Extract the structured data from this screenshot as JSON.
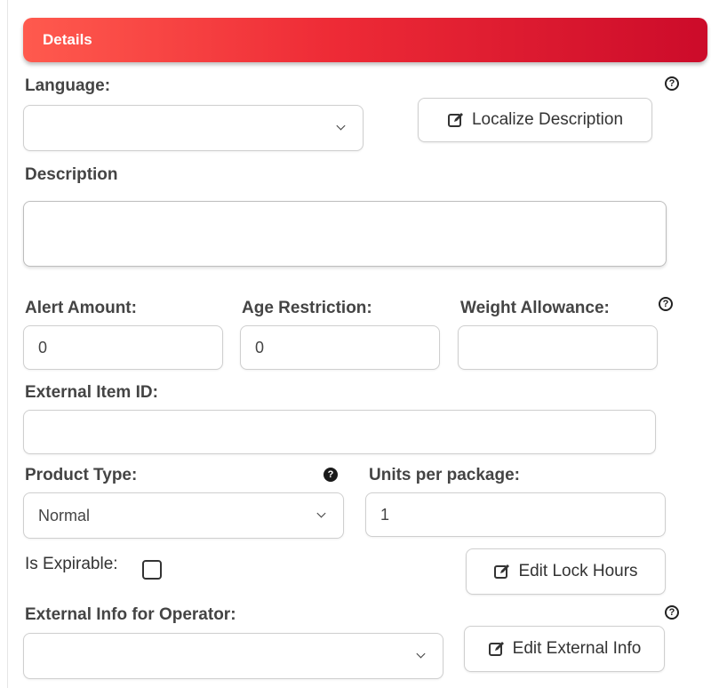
{
  "header": {
    "title": "Details"
  },
  "language": {
    "label": "Language:",
    "value": ""
  },
  "localize_button": {
    "label": "Localize Description"
  },
  "description": {
    "label": "Description",
    "value": ""
  },
  "alert_amount": {
    "label": "Alert Amount:",
    "value": "0"
  },
  "age_restriction": {
    "label": "Age Restriction:",
    "value": "0"
  },
  "weight_allowance": {
    "label": "Weight Allowance:",
    "value": ""
  },
  "external_item_id": {
    "label": "External Item ID:",
    "value": ""
  },
  "product_type": {
    "label": "Product Type:",
    "value": "Normal"
  },
  "units_per_package": {
    "label": "Units per package:",
    "value": "1"
  },
  "is_expirable": {
    "label": "Is Expirable:",
    "checked": false
  },
  "edit_lock_hours_button": {
    "label": "Edit Lock Hours"
  },
  "external_info": {
    "label": "External Info for Operator:",
    "value": ""
  },
  "edit_external_info_button": {
    "label": "Edit External Info"
  },
  "help_glyph": "?",
  "colors": {
    "header_start": "#ff5a4e",
    "header_end": "#cc0b2a"
  }
}
